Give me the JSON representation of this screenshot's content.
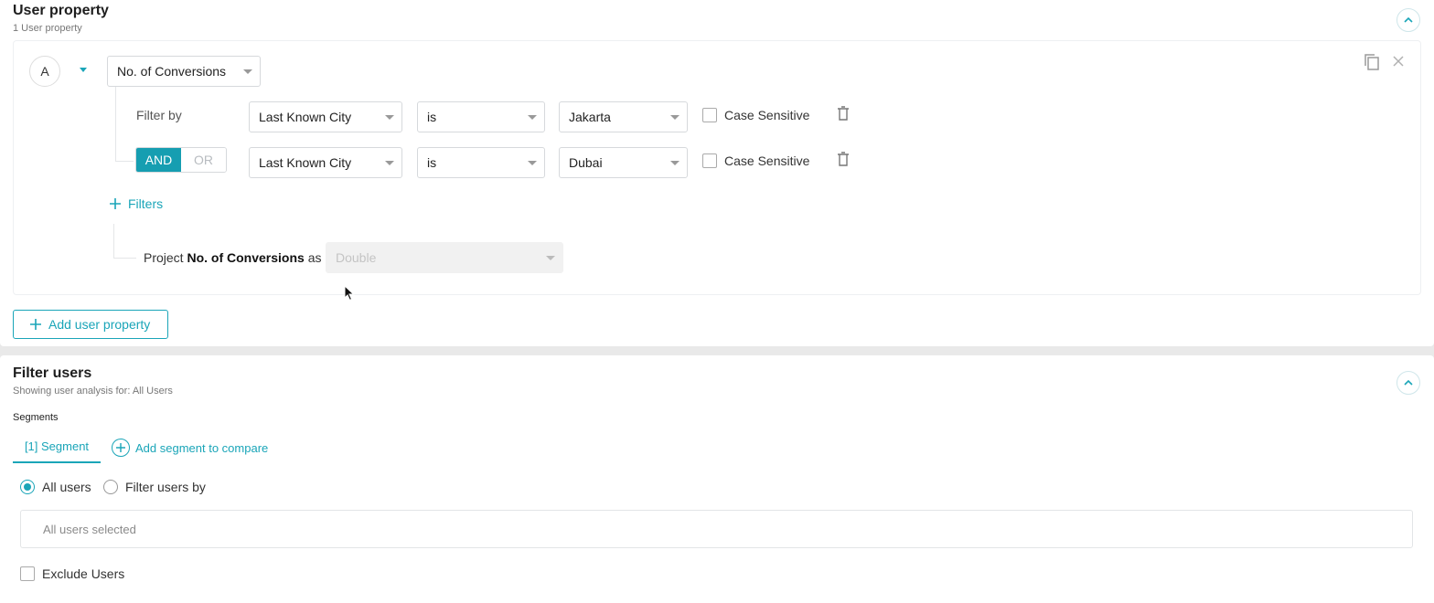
{
  "user_property": {
    "title": "User property",
    "subtitle": "1 User property",
    "item": {
      "letter": "A",
      "property": "No. of Conversions",
      "filter_by_label": "Filter by",
      "filters": [
        {
          "field": "Last Known City",
          "operator": "is",
          "value": "Jakarta",
          "case_label": "Case Sensitive"
        },
        {
          "field": "Last Known City",
          "operator": "is",
          "value": "Dubai",
          "case_label": "Case Sensitive"
        }
      ],
      "and_label": "AND",
      "or_label": "OR",
      "add_filters_label": "Filters",
      "project_prefix": "Project",
      "project_property": "No. of Conversions",
      "project_suffix": "as",
      "project_type_placeholder": "Double"
    },
    "add_button_label": "Add user property"
  },
  "filter_users": {
    "title": "Filter users",
    "subtitle": "Showing user analysis for: All Users",
    "segments_label": "Segments",
    "segment_tab_label": "[1] Segment",
    "add_segment_label": "Add segment to compare",
    "radio_all_users": "All users",
    "radio_filter_users": "Filter users by",
    "selection_text": "All users selected",
    "exclude_label": "Exclude Users"
  },
  "colors": {
    "accent": "#1aa5b8",
    "and_active": "#169eb1"
  }
}
